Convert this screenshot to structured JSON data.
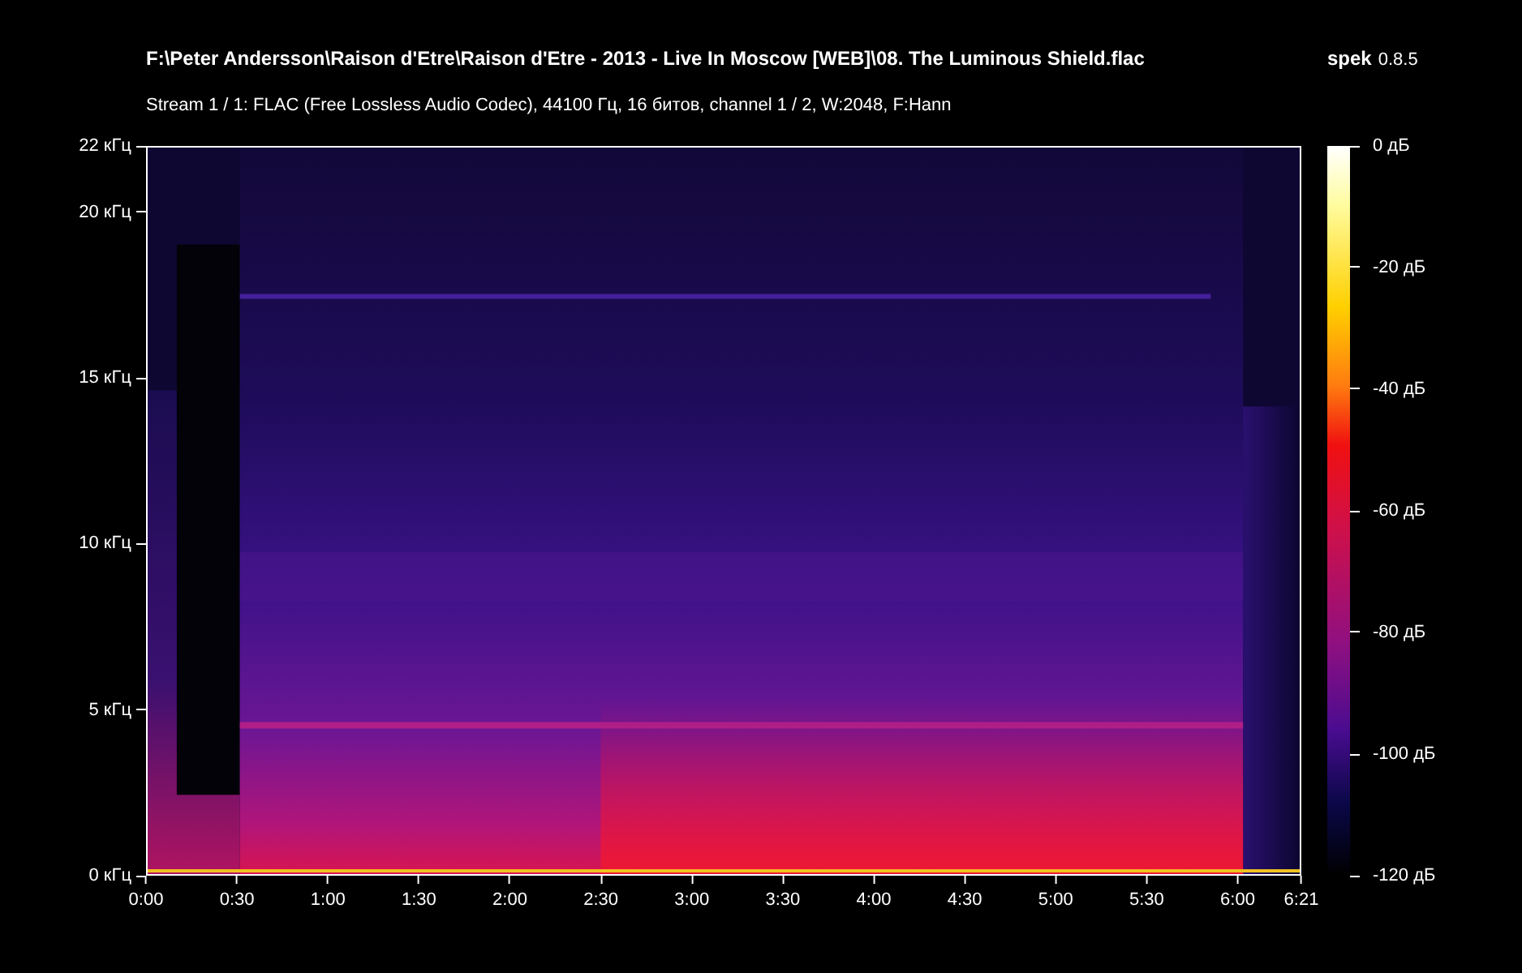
{
  "title": "F:\\Peter Andersson\\Raison d'Etre\\Raison d'Etre - 2013 - Live In Moscow [WEB]\\08. The Luminous Shield.flac",
  "app": {
    "name": "spek",
    "version": "0.8.5"
  },
  "stream_info": "Stream 1 / 1: FLAC (Free Lossless Audio Codec), 44100 Гц, 16 битов, channel 1 / 2, W:2048, F:Hann",
  "frequency_axis": [
    "22 кГц",
    "20 кГц",
    "15 кГц",
    "10 кГц",
    "5 кГц",
    "0 кГц"
  ],
  "time_axis": [
    "0:00",
    "0:30",
    "1:00",
    "1:30",
    "2:00",
    "2:30",
    "3:00",
    "3:30",
    "4:00",
    "4:30",
    "5:00",
    "5:30",
    "6:00",
    "6:21"
  ],
  "level_scale": [
    "0 дБ",
    "-20 дБ",
    "-40 дБ",
    "-60 дБ",
    "-80 дБ",
    "-100 дБ",
    "-120 дБ"
  ]
}
